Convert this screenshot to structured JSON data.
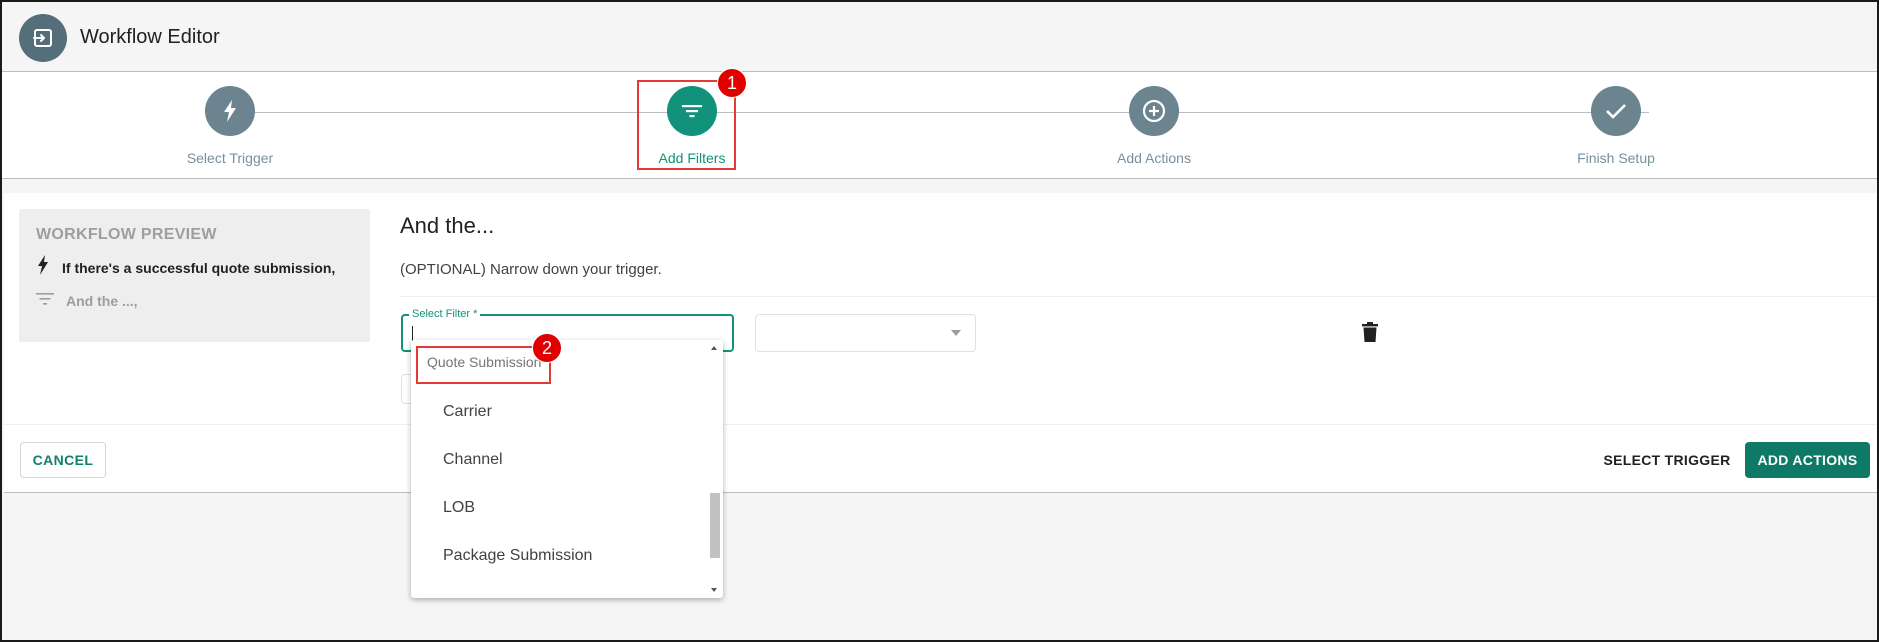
{
  "app": {
    "title": "Workflow Editor"
  },
  "stepper": {
    "steps": [
      {
        "label": "Select Trigger",
        "icon": "lightning-icon",
        "active": false
      },
      {
        "label": "Add Filters",
        "icon": "filter-icon",
        "active": true
      },
      {
        "label": "Add Actions",
        "icon": "add-circle-icon",
        "active": false
      },
      {
        "label": "Finish Setup",
        "icon": "check-icon",
        "active": false
      }
    ]
  },
  "annotations": {
    "badge1": "1",
    "badge2": "2"
  },
  "preview": {
    "title": "WORKFLOW PREVIEW",
    "trigger_text": "If there's a successful quote submission,",
    "filter_text": "And the ...,"
  },
  "main": {
    "heading": "And the...",
    "subtext": "(OPTIONAL) Narrow down your trigger.",
    "select_filter_label": "Select Filter *"
  },
  "dropdown": {
    "group_label": "Quote Submission",
    "items": [
      "Carrier",
      "Channel",
      "LOB",
      "Package Submission"
    ]
  },
  "footer": {
    "cancel_label": "CANCEL",
    "select_trigger_label": "SELECT TRIGGER",
    "add_actions_label": "ADD ACTIONS"
  },
  "colors": {
    "accent": "#12917b",
    "step_inactive": "#6b848f",
    "primary_button": "#0e7a66",
    "annotation_red": "#e53935"
  }
}
